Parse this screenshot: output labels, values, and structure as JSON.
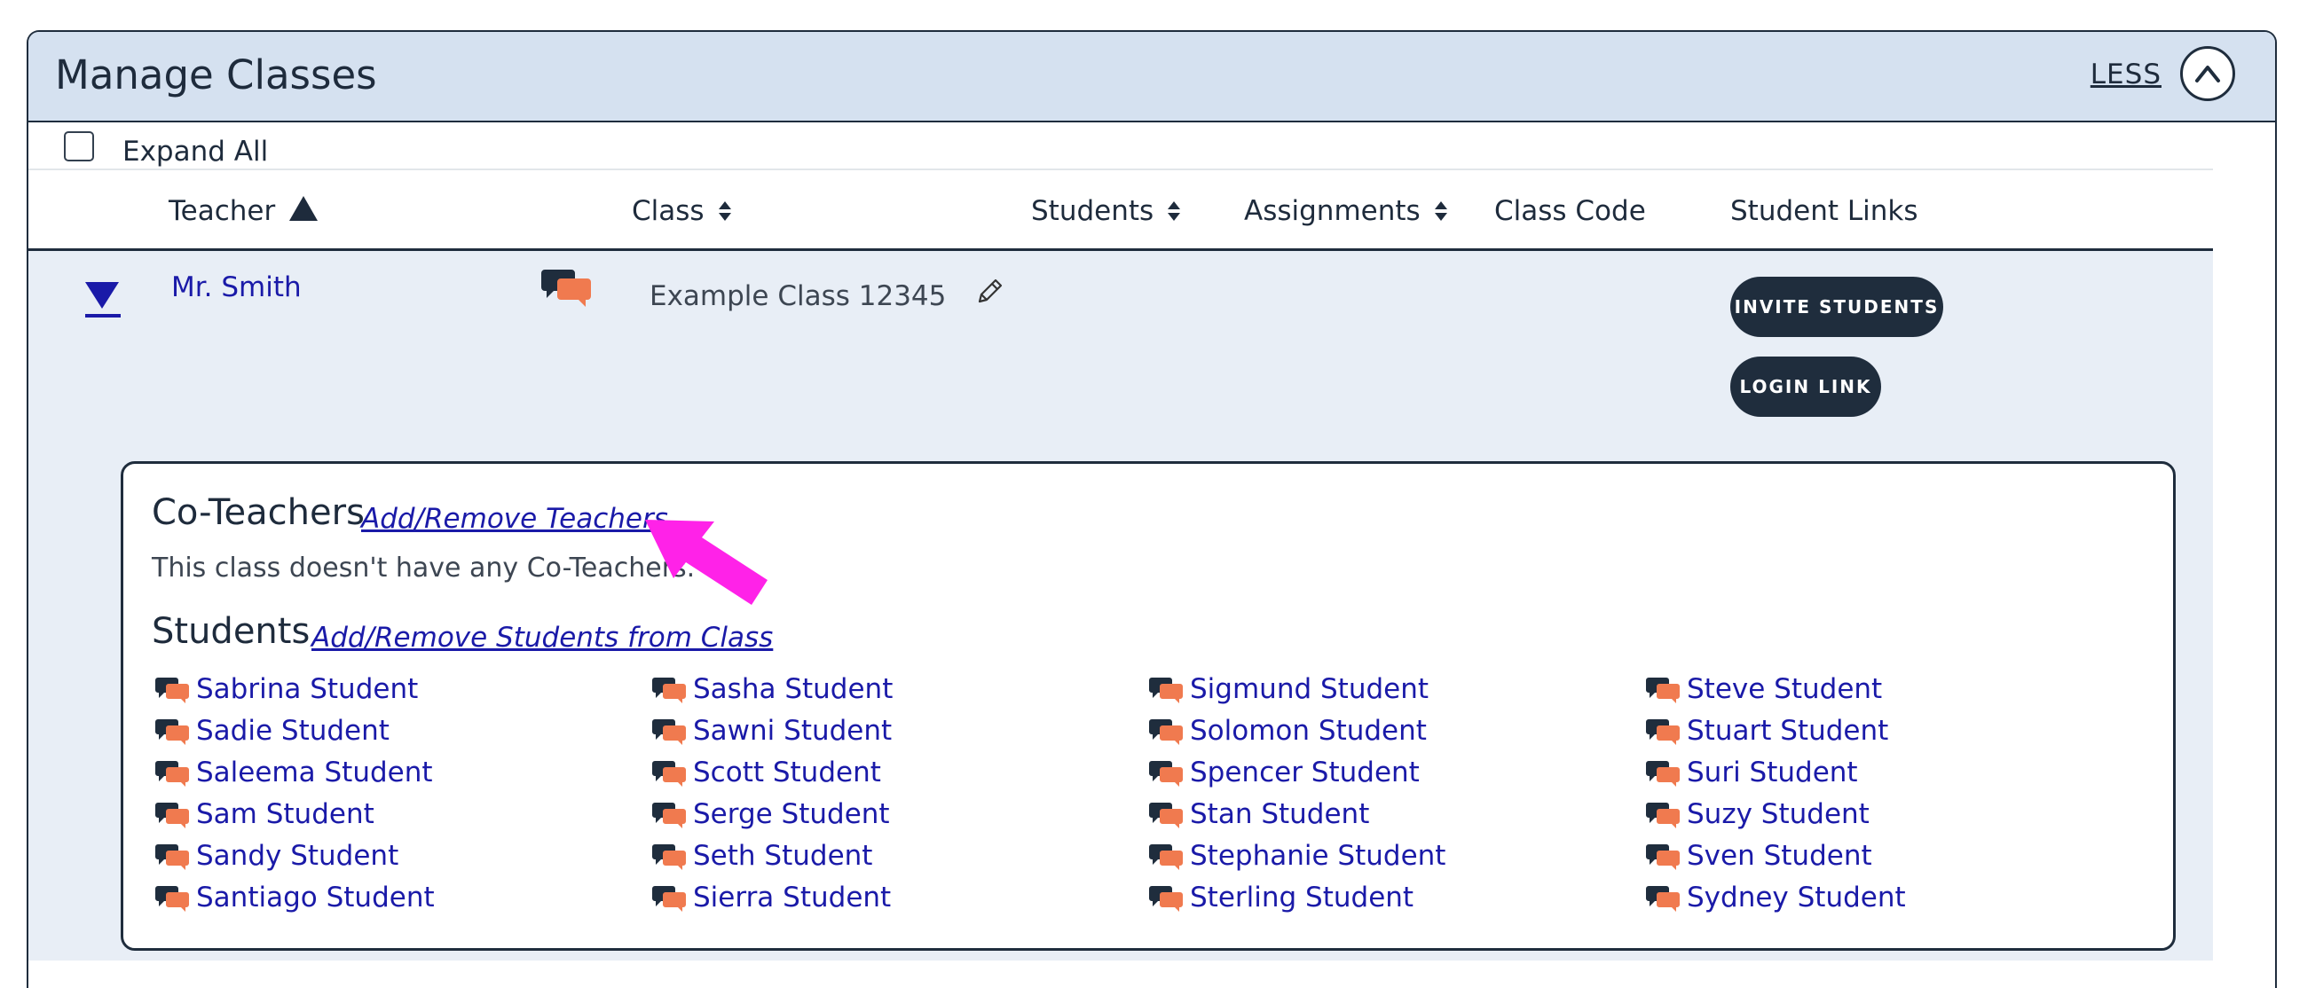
{
  "panel": {
    "title": "Manage Classes",
    "less_label": "LESS"
  },
  "controls": {
    "expand_all_label": "Expand All",
    "expand_all_checked": false
  },
  "table": {
    "headers": [
      "Teacher",
      "Class",
      "Students",
      "Assignments",
      "Class Code",
      "Student Links"
    ]
  },
  "row": {
    "teacher": "Mr. Smith",
    "class_name": "Example Class 12345",
    "invite_label": "INVITE STUDENTS",
    "login_label": "LOGIN LINK"
  },
  "detail": {
    "co_teachers_title": "Co-Teachers",
    "co_teachers_link": "Add/Remove Teachers",
    "co_teachers_empty": "This class doesn't have any Co-Teachers.",
    "students_title": "Students",
    "students_link": "Add/Remove Students from Class",
    "students": [
      [
        "Sabrina Student",
        "Sadie Student",
        "Saleema Student",
        "Sam Student",
        "Sandy Student",
        "Santiago Student"
      ],
      [
        "Sasha Student",
        "Sawni Student",
        "Scott Student",
        "Serge Student",
        "Seth Student",
        "Sierra Student"
      ],
      [
        "Sigmund Student",
        "Solomon Student",
        "Spencer Student",
        "Stan Student",
        "Stephanie Student",
        "Sterling Student"
      ],
      [
        "Steve Student",
        "Stuart Student",
        "Suri Student",
        "Suzy Student",
        "Sven Student",
        "Sydney Student"
      ]
    ]
  },
  "colors": {
    "header_bg": "#d5e1f0",
    "dark_navy": "#1f2d3d",
    "link_blue": "#1a1aa8",
    "accent_orange": "#f07a4f",
    "annotation_magenta": "#ff22e8",
    "row_bg": "#e8eef6"
  }
}
